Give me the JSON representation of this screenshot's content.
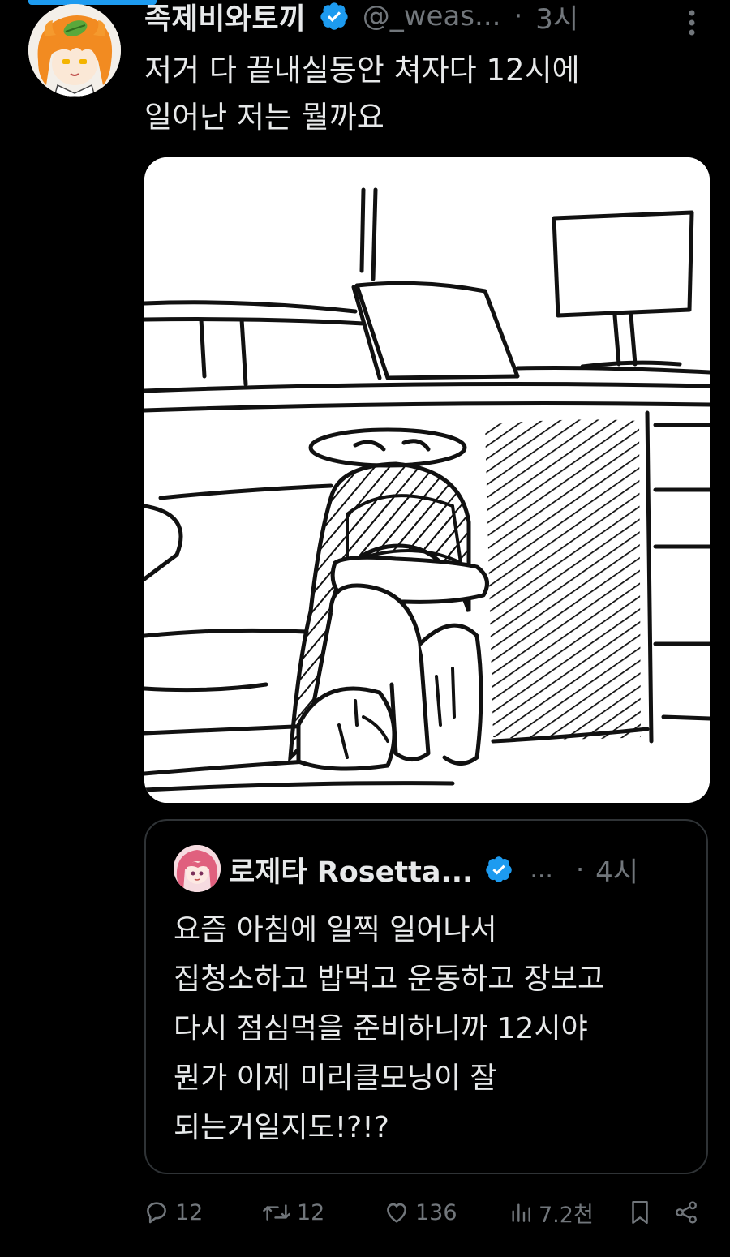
{
  "tweet": {
    "author": {
      "display_name": "족제비와토끼",
      "handle": "@_weas...",
      "avatar_icon": "profile-avatar-orange-hair-leaf"
    },
    "separator": "·",
    "time": "3시",
    "text": "저거 다 끝내실동안 쳐자다 12시에\n일어난 저는 뭘까요",
    "media_description_icon": "sketch-girl-hugging-knees-in-office"
  },
  "quote": {
    "author": {
      "display_name": "로제타 Rosetta...",
      "ellipsis": "...",
      "avatar_icon": "profile-avatar-pink-hair"
    },
    "separator": "·",
    "time": "4시",
    "text": "요즘 아침에 일찍 일어나서\n집청소하고 밥먹고 운동하고 장보고\n다시 점심먹을 준비하니까 12시야\n뭔가 이제 미리클모닝이 잘\n되는거일지도!?!?"
  },
  "actions": {
    "replies": "12",
    "retweets": "12",
    "likes": "136",
    "views": "7.2천"
  },
  "colors": {
    "background": "#000000",
    "text_primary": "#e7e9ea",
    "text_secondary": "#71767b",
    "border": "#2f3336",
    "verified_blue": "#1d9bf0"
  }
}
